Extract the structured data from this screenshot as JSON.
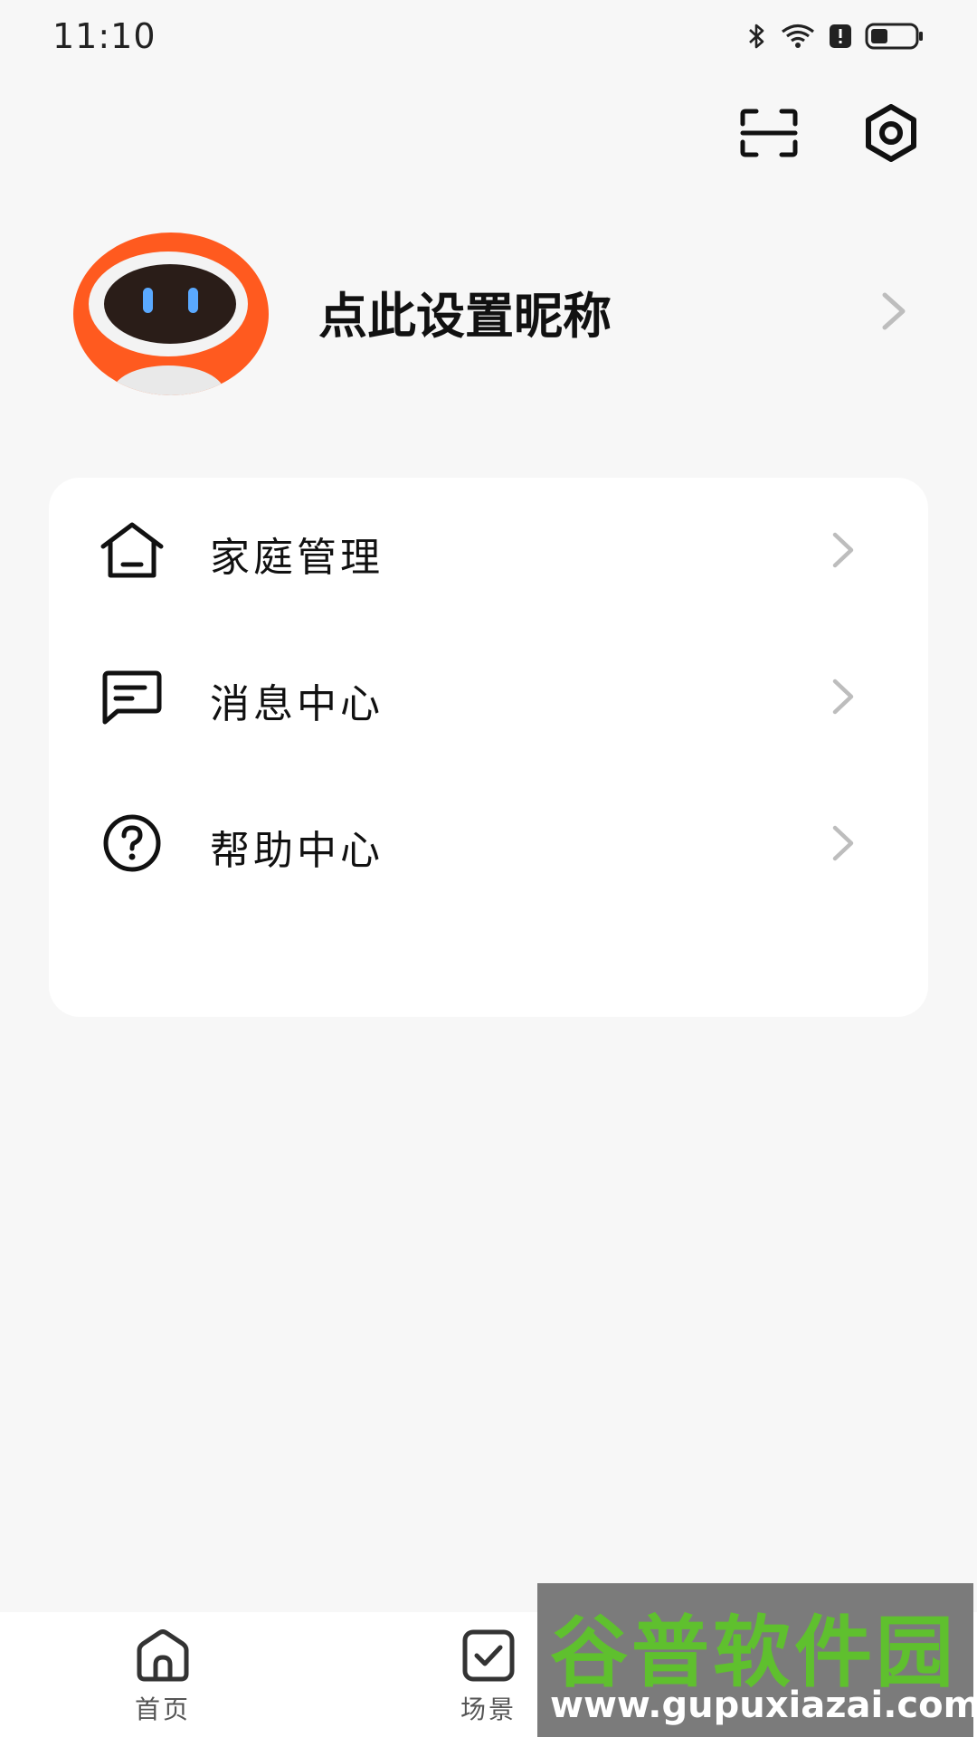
{
  "status_bar": {
    "time": "11:10",
    "icons": [
      "bluetooth-icon",
      "wifi-icon",
      "alert-icon",
      "battery-icon"
    ]
  },
  "top_actions": {
    "icons": [
      "scan-icon",
      "settings-icon"
    ]
  },
  "profile": {
    "nickname": "点此设置昵称"
  },
  "menu": {
    "items": [
      {
        "label": "家庭管理",
        "icon": "home-icon"
      },
      {
        "label": "消息中心",
        "icon": "message-icon"
      },
      {
        "label": "帮助中心",
        "icon": "help-icon"
      }
    ]
  },
  "bottom_nav": {
    "items": [
      {
        "label": "首页",
        "icon": "home-icon"
      },
      {
        "label": "场景",
        "icon": "checkbox-icon"
      }
    ]
  },
  "watermark": {
    "title": "谷普软件园",
    "url": "www.gupuxiazai.com"
  },
  "colors": {
    "background": "#f7f7f7",
    "card": "#ffffff",
    "avatar_orange": "#ff5a1f",
    "chevron": "#bdbdbd",
    "watermark_green": "#5fc02e"
  }
}
